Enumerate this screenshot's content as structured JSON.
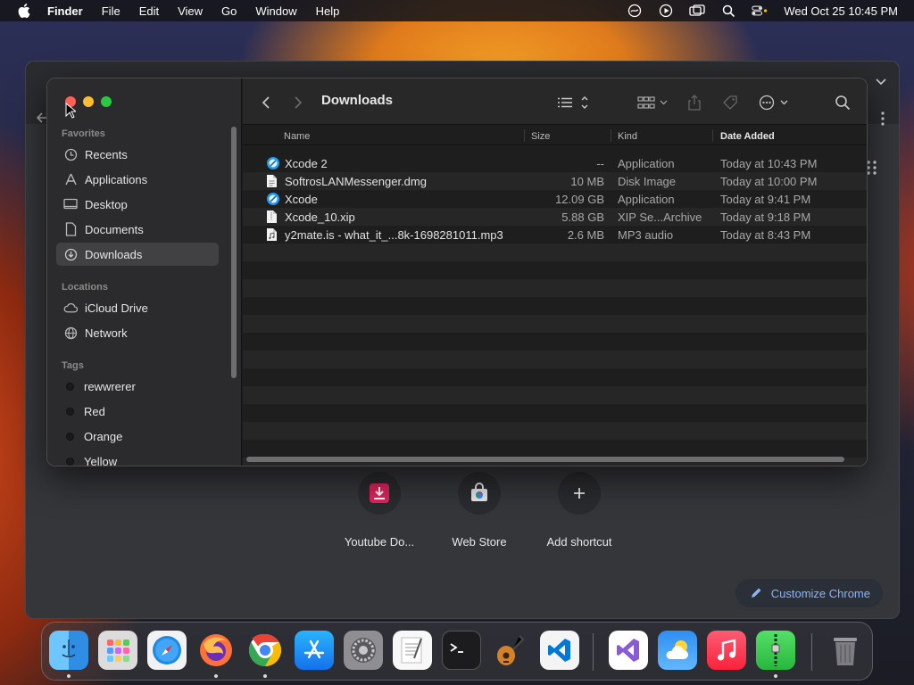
{
  "menubar": {
    "app": "Finder",
    "items": [
      "File",
      "Edit",
      "View",
      "Go",
      "Window",
      "Help"
    ],
    "clock": "Wed Oct 25  10:45 PM"
  },
  "chrome": {
    "shortcuts": [
      {
        "label": "Youtube Do...",
        "icon": "youtube-downloader-icon"
      },
      {
        "label": "Web Store",
        "icon": "web-store-icon"
      },
      {
        "label": "Add shortcut",
        "icon": "plus-icon"
      }
    ],
    "customize_label": "Customize Chrome"
  },
  "finder": {
    "title": "Downloads",
    "sidebar": {
      "favorites_title": "Favorites",
      "favorites": [
        "Recents",
        "Applications",
        "Desktop",
        "Documents",
        "Downloads"
      ],
      "selected": "Downloads",
      "locations_title": "Locations",
      "locations": [
        "iCloud Drive",
        "Network"
      ],
      "tags_title": "Tags",
      "tags": [
        "rewwrerer",
        "Red",
        "Orange",
        "Yellow"
      ]
    },
    "columns": {
      "name": "Name",
      "size": "Size",
      "kind": "Kind",
      "date": "Date Added"
    },
    "files": [
      {
        "name": "Xcode 2",
        "size": "--",
        "kind": "Application",
        "date": "Today at 10:43 PM",
        "icon": "app-icon"
      },
      {
        "name": "SoftrosLANMessenger.dmg",
        "size": "10 MB",
        "kind": "Disk Image",
        "date": "Today at 10:00 PM",
        "icon": "document-icon"
      },
      {
        "name": "Xcode",
        "size": "12.09 GB",
        "kind": "Application",
        "date": "Today at 9:41 PM",
        "icon": "app-icon"
      },
      {
        "name": "Xcode_10.xip",
        "size": "5.88 GB",
        "kind": "XIP Se...Archive",
        "date": "Today at 9:18 PM",
        "icon": "document-icon"
      },
      {
        "name": "y2mate.is - what_it_...8k-1698281011.mp3",
        "size": "2.6 MB",
        "kind": "MP3 audio",
        "date": "Today at 8:43 PM",
        "icon": "audio-file-icon"
      }
    ]
  },
  "dock": [
    "Finder",
    "Launchpad",
    "Safari",
    "Firefox",
    "Google Chrome",
    "App Store",
    "System Settings",
    "TextEdit",
    "Terminal",
    "GarageBand",
    "Visual Studio Code",
    "Visual Studio",
    "Weather",
    "Music",
    "Archive Utility",
    "Trash"
  ]
}
